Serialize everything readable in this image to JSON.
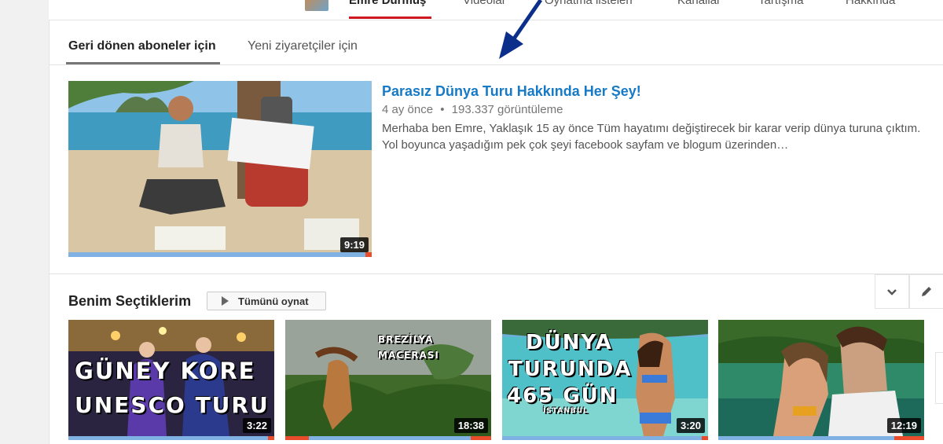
{
  "channel_nav": {
    "tabs": [
      "Emre Durmuş",
      "Videolar",
      "Oynatma listeleri",
      "Kanallar",
      "Tartışma",
      "Hakkında"
    ]
  },
  "subtabs": {
    "returning": "Geri dönen aboneler için",
    "new_visitors": "Yeni ziyaretçiler için"
  },
  "featured": {
    "title": "Parasız Dünya Turu Hakkında Her Şey!",
    "age": "4 ay önce",
    "separator": "•",
    "views": "193.337 görüntüleme",
    "description": "Merhaba ben Emre, Yaklaşık 15 ay önce Tüm hayatımı değiştirecek bir karar verip dünya turuna çıktım. Yol boyunca yaşadığım pek çok şeyi facebook sayfam ve blogum üzerinden…",
    "duration": "9:19",
    "progress": 0.98
  },
  "section": {
    "title": "Benim Seçtiklerim",
    "play_all": "Tümünü oynat"
  },
  "videos": [
    {
      "overlay": [
        "GÜNEY KORE",
        "UNESCO TURU"
      ],
      "duration": "3:22"
    },
    {
      "overlay": [
        "BREZİLYA",
        "MACERASI"
      ],
      "duration": "18:38"
    },
    {
      "overlay": [
        "DÜNYA",
        "TURUNDA",
        "465 GÜN",
        "İSTANBUL"
      ],
      "duration": "3:20"
    },
    {
      "overlay": [],
      "duration": "12:19"
    }
  ],
  "colors": {
    "link": "#167ac6",
    "accent_red": "#cc181e",
    "progress_blue": "#7fb1e3",
    "arrow": "#0b2f8a"
  },
  "icons": {
    "play_all": "play-icon",
    "collapse": "chevron-down-icon",
    "edit": "pencil-icon",
    "annotation": "arrow-icon"
  }
}
